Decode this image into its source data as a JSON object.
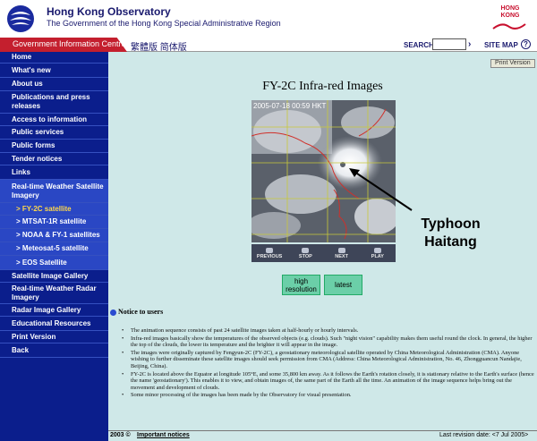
{
  "header": {
    "org_name": "Hong Kong Observatory",
    "org_sub": "The Government of the Hong Kong Special Administrative Region",
    "brand_line1": "HONG",
    "brand_line2": "KONG"
  },
  "topbar": {
    "gic": "Government Information Centre",
    "lang": "繁體版  简体版",
    "search_label": "SEARCH",
    "search_go": "›",
    "sitemap": "SITE MAP",
    "help": "?"
  },
  "sidebar": {
    "items": [
      {
        "label": "Home"
      },
      {
        "label": "What's new"
      },
      {
        "label": "About us"
      },
      {
        "label": "Publications and press releases"
      },
      {
        "label": "Access to information"
      },
      {
        "label": "Public services"
      },
      {
        "label": "Public forms"
      },
      {
        "label": "Tender notices"
      },
      {
        "label": "Links"
      },
      {
        "label": "Real-time Weather Satellite Imagery"
      },
      {
        "label": "> FY-2C satellite"
      },
      {
        "label": "> MTSAT-1R satellite"
      },
      {
        "label": "> NOAA & FY-1 satellites"
      },
      {
        "label": "> Meteosat-5 satellite"
      },
      {
        "label": "> EOS Satellite"
      },
      {
        "label": "Satellite Image Gallery"
      },
      {
        "label": "Real-time Weather Radar Imagery"
      },
      {
        "label": "Radar Image Gallery"
      },
      {
        "label": "Educational Resources"
      },
      {
        "label": "Print Version"
      },
      {
        "label": "Back"
      }
    ]
  },
  "main": {
    "print_version": "Print Version",
    "title": "FY-2C Infra-red Images",
    "timestamp": "2005-07-18 00:59 HKT",
    "controls": [
      "PREVIOUS",
      "STOP",
      "NEXT",
      "PLAY"
    ],
    "btn_high": "high resolution",
    "btn_latest": "latest",
    "typhoon_line1": "Typhoon",
    "typhoon_line2": "Haitang",
    "notice_head": "Notice to users",
    "notes": [
      "The animation sequence consists of past 24 satellite images taken at half-hourly or hourly intervals.",
      "Infra-red images basically show the temperatures of the observed objects (e.g. clouds). Such \"night vision\" capability makes them useful round the clock. In general, the higher the top of the clouds, the lower its temperature and the brighter it will appear in the image.",
      "The images were originally captured by Fengyun-2C (FY-2C), a geostationary meteorological satellite operated by China Meteorological Administration (CMA). Anyone wishing to further disseminate these satellite images should seek permission from CMA (Address: China Meteorological Administration, No. 46, Zhongguancun Nandajie, Beijing, China).",
      "FY-2C is located above the Equator at longitude 105°E, and some 35,800 km away. As it follows the Earth's rotation closely, it is stationary relative to the Earth's surface (hence the name 'geostationary'). This enables it to view, and obtain images of, the same part of the Earth all the time. An animation of the image sequence helps bring out the movement and development of clouds.",
      "Some minor processing of the images has been made by the Observatory for visual presentation."
    ]
  },
  "footer": {
    "copyright": "2003 ©",
    "important": "Important notices",
    "revision": "Last revision date: <7 Jul 2005>"
  },
  "colors": {
    "nav_bg": "#0b1e8c",
    "nav_sel": "#2a47c4",
    "gic_red": "#c41f2e",
    "page_bg": "#cfe8e8",
    "button": "#6bcfa8"
  }
}
